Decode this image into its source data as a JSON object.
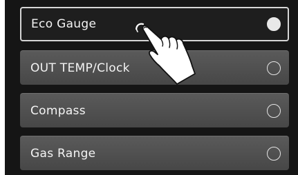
{
  "menu": {
    "options": [
      {
        "label": "Eco Gauge",
        "selected": true
      },
      {
        "label": "OUT TEMP/Clock",
        "selected": false
      },
      {
        "label": "Compass",
        "selected": false
      },
      {
        "label": "Gas Range",
        "selected": false
      }
    ]
  },
  "colors": {
    "screen_background": "#151515",
    "option_fill": "#4f4f4f",
    "selected_fill": "#1e1e1e",
    "selected_border": "#d6d6d6",
    "text": "#f4f4f4"
  },
  "icons": {
    "pointer": "pointing-hand-icon",
    "radio_on": "radio-selected-icon",
    "radio_off": "radio-unselected-icon"
  }
}
